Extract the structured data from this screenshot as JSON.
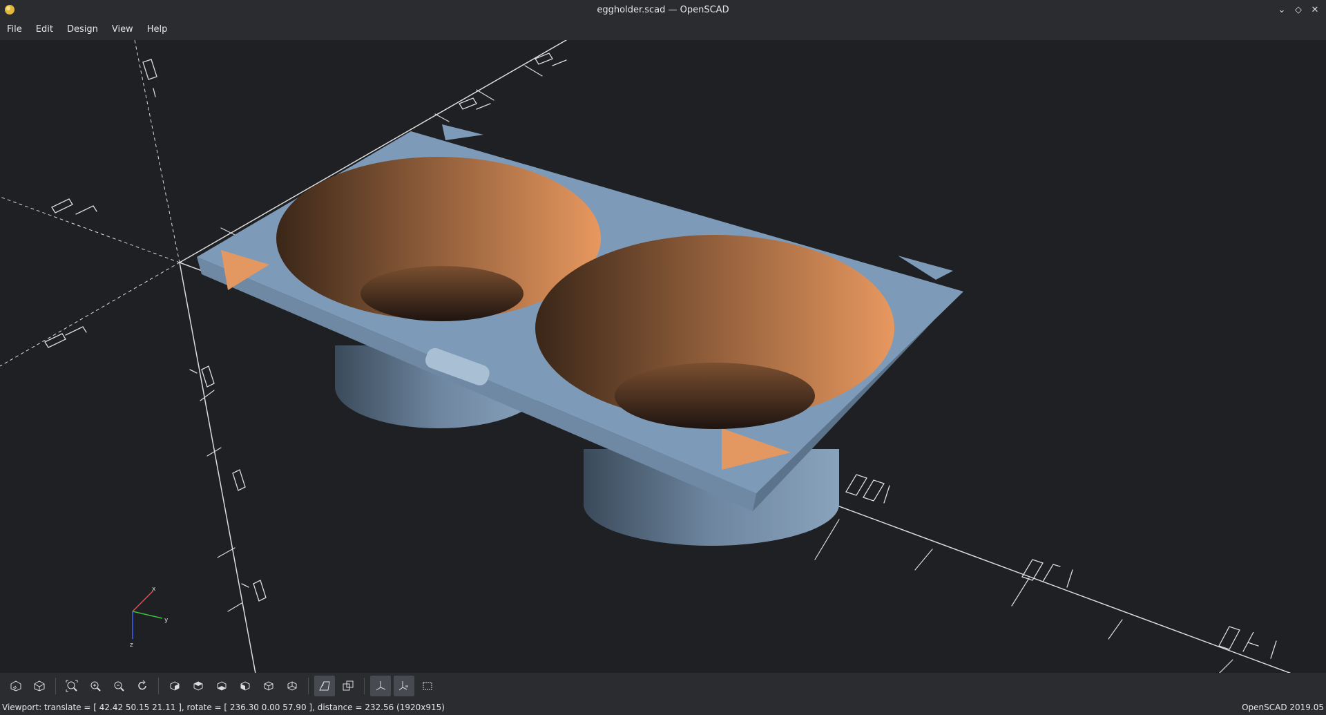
{
  "window": {
    "title": "eggholder.scad — OpenSCAD",
    "controls": [
      "minimize-icon",
      "maximize-icon",
      "close-icon"
    ]
  },
  "menu": [
    "File",
    "Edit",
    "Design",
    "View",
    "Help"
  ],
  "viewport": {
    "background": "#1f2023",
    "model_top_color": "#7d9bb8",
    "model_cut_color": "#e39761",
    "axis_labels": {
      "x": "x",
      "y": "y",
      "z": "z"
    }
  },
  "toolbar": {
    "buttons": [
      {
        "icon": "preview-icon"
      },
      {
        "icon": "render-icon"
      },
      {
        "icon": "view-all-icon"
      },
      {
        "icon": "zoom-in-icon"
      },
      {
        "icon": "zoom-out-icon"
      },
      {
        "icon": "reset-view-icon"
      },
      {
        "icon": "view-right-icon"
      },
      {
        "icon": "view-top-icon"
      },
      {
        "icon": "view-bottom-icon"
      },
      {
        "icon": "view-left-icon"
      },
      {
        "icon": "view-front-icon"
      },
      {
        "icon": "view-back-icon"
      },
      {
        "icon": "perspective-icon",
        "active": true
      },
      {
        "icon": "orthogonal-icon"
      },
      {
        "icon": "show-axes-icon",
        "active": true
      },
      {
        "icon": "show-scale-markers-icon",
        "active": true
      },
      {
        "icon": "show-edges-icon"
      }
    ]
  },
  "status": {
    "viewport": "Viewport: translate = [ 42.42 50.15 21.11 ], rotate = [ 236.30 0.00 57.90 ], distance = 232.56 (1920x915)",
    "version": "OpenSCAD 2019.05"
  }
}
